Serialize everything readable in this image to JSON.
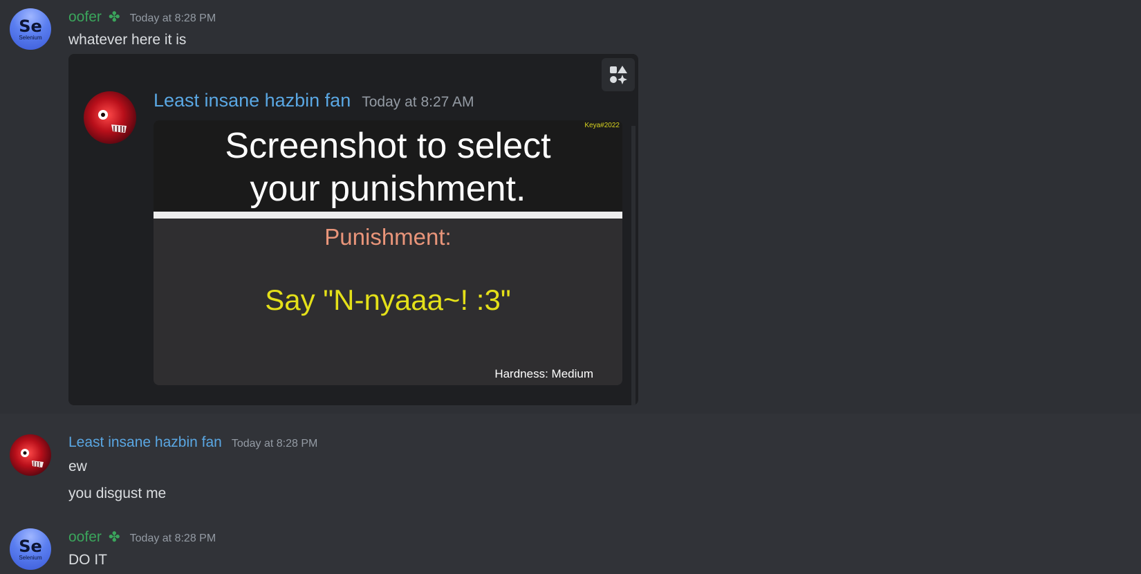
{
  "messages": [
    {
      "username": "oofer",
      "badge_icon": "four-leaf-clover-icon",
      "timestamp": "Today at 8:28 PM",
      "avatar": {
        "symbol": "Se",
        "name": "Selenium"
      },
      "text": "whatever here it is",
      "embed": {
        "button_icon": "apps-icon",
        "username": "Least insane hazbin fan",
        "timestamp": "Today at 8:27 AM",
        "image": {
          "watermark": "Keya#2022",
          "title_line1": "Screenshot to select",
          "title_line2": "your punishment.",
          "punishment_label": "Punishment:",
          "punishment_text": "Say \"N-nyaaa~! :3\"",
          "hardness": "Hardness: Medium"
        }
      }
    },
    {
      "username": "Least insane hazbin fan",
      "timestamp": "Today at 8:28 PM",
      "lines": [
        "ew",
        "you disgust me"
      ]
    },
    {
      "username": "oofer",
      "badge_icon": "four-leaf-clover-icon",
      "timestamp": "Today at 8:28 PM",
      "avatar": {
        "symbol": "Se",
        "name": "Selenium"
      },
      "text": "DO IT"
    }
  ],
  "colors": {
    "background": "#313338",
    "highlight": "#2e3035",
    "oofer_name": "#3ba55c",
    "hazbin_name": "#5aa7e3",
    "timestamp": "#949ba4"
  }
}
